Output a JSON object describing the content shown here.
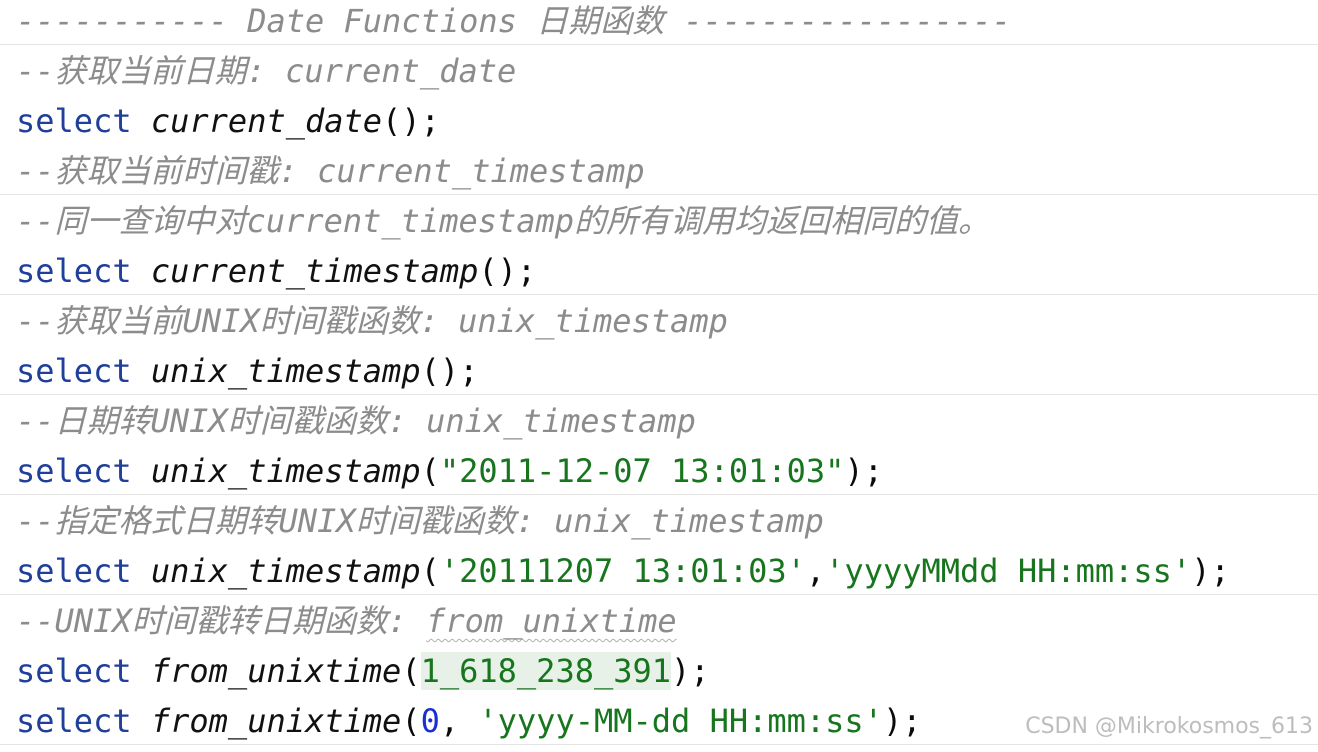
{
  "editor": {
    "header_comment": "----------- Date Functions 日期函数 -----------------",
    "lines": [
      {
        "comment": "--获取当前日期: current_date"
      },
      {
        "kw": "select",
        "fn": "current_date",
        "args_open": "(",
        "args_close": ");"
      },
      {
        "comment": "--获取当前时间戳: current_timestamp"
      },
      {
        "comment": "--同一查询中对current_timestamp的所有调用均返回相同的值。"
      },
      {
        "kw": "select",
        "fn": "current_timestamp",
        "args_open": "(",
        "args_close": ");"
      },
      {
        "comment": "--获取当前UNIX时间戳函数: unix_timestamp"
      },
      {
        "kw": "select",
        "fn": "unix_timestamp",
        "args_open": "(",
        "args_close": ");"
      },
      {
        "comment": "--日期转UNIX时间戳函数: unix_timestamp"
      },
      {
        "kw": "select",
        "fn": "unix_timestamp",
        "args_open": "(",
        "arg1": "\"2011-12-07 13:01:03\"",
        "args_close": ");"
      },
      {
        "comment": "--指定格式日期转UNIX时间戳函数: unix_timestamp"
      },
      {
        "kw": "select",
        "fn": "unix_timestamp",
        "args_open": "(",
        "arg1": "'20111207 13:01:03'",
        "comma": ",",
        "arg2": "'yyyyMMdd HH:mm:ss'",
        "args_close": ");"
      },
      {
        "comment_prefix": "--UNIX时间戳转日期函数: ",
        "comment_fn": "from_unixtime"
      },
      {
        "kw": "select",
        "fn": "from_unixtime",
        "args_open": "(",
        "num": "1_618_238_391",
        "args_close": ");"
      },
      {
        "kw": "select",
        "fn": "from_unixtime",
        "args_open": "(",
        "num": "0",
        "comma": ", ",
        "arg2": "'yyyy-MM-dd HH:mm:ss'",
        "args_close": ");"
      }
    ]
  },
  "watermark": "CSDN @Mikrokosmos_613",
  "colors": {
    "keyword": "#1f3f9a",
    "comment": "#8c8c8c",
    "string": "#17751e",
    "number": "#1a2fd0",
    "background": "#ffffff"
  }
}
